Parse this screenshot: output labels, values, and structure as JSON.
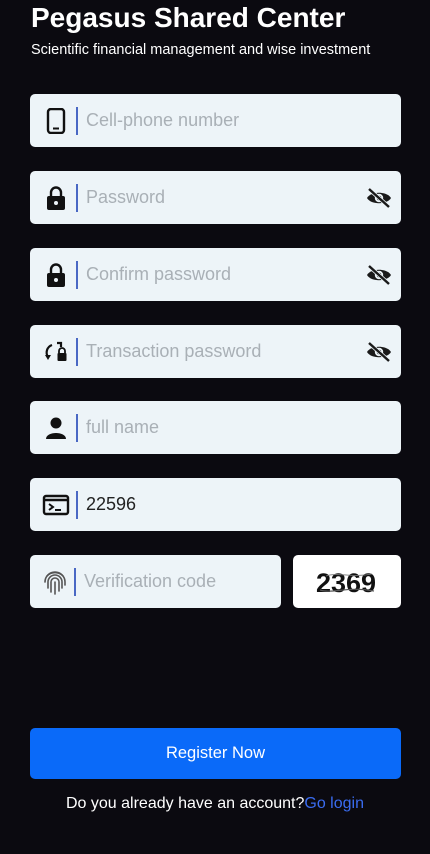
{
  "header": {
    "title": "Pegasus Shared Center",
    "subtitle": "Scientific financial management and wise investment"
  },
  "form": {
    "phone": {
      "placeholder": "Cell-phone number",
      "value": "",
      "icon": "phone-icon"
    },
    "password": {
      "placeholder": "Password",
      "value": "",
      "icon": "lock-icon",
      "toggle_icon": "eye-off-icon"
    },
    "confirm_password": {
      "placeholder": "Confirm password",
      "value": "",
      "icon": "lock-icon",
      "toggle_icon": "eye-off-icon"
    },
    "transaction_password": {
      "placeholder": "Transaction password",
      "value": "",
      "icon": "lock-reset-icon",
      "toggle_icon": "eye-off-icon"
    },
    "full_name": {
      "placeholder": "full name",
      "value": "",
      "icon": "person-icon"
    },
    "invite_code": {
      "placeholder": "",
      "value": "22596",
      "icon": "terminal-icon"
    },
    "verification_code": {
      "placeholder": "Verification code",
      "value": "",
      "icon": "fingerprint-icon"
    },
    "captcha_text": "2369"
  },
  "actions": {
    "register_label": "Register Now",
    "footer_text": "Do you already have an account?",
    "login_link": "Go login"
  },
  "colors": {
    "background": "#0b0a10",
    "field_bg": "#edf4f8",
    "accent": "#0a6af9",
    "link": "#3a6cf0"
  }
}
